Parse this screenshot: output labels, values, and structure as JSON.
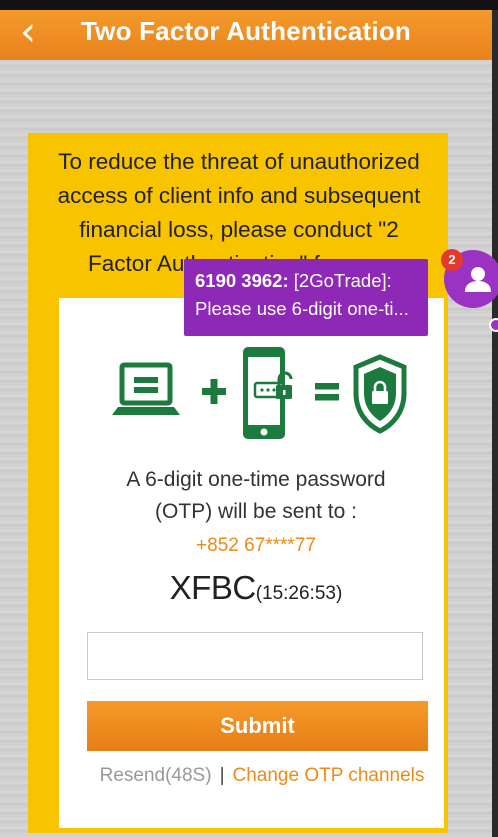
{
  "header": {
    "title": "Two Factor Authentication",
    "back_icon": "chevron-left-icon"
  },
  "notice": {
    "text": "To reduce the threat of unauthorized access of client info and subsequent financial loss, please conduct \"2 Factor Authentication\" for your"
  },
  "illustration": {
    "icons": [
      "laptop-icon",
      "plus-icon",
      "smartphone-unlock-icon",
      "equals-icon",
      "shield-lock-icon"
    ],
    "color": "#1d7a3e"
  },
  "otp": {
    "line1": "A 6-digit one-time password",
    "line2": "(OTP) will be sent to :",
    "phone": "+852 67****77",
    "code": "XFBC",
    "time": "(15:26:53)",
    "input_value": "",
    "input_placeholder": ""
  },
  "actions": {
    "submit_label": "Submit",
    "resend_label": "Resend(48S)",
    "separator": "|",
    "change_label": "Change OTP channels"
  },
  "notification": {
    "sender": "6190 3962:",
    "line1_rest": " [2GoTrade]:",
    "line2": "Please use 6-digit one-ti...",
    "badge_count": "2",
    "avatar_icon": "person-icon"
  },
  "colors": {
    "accent": "#ef8a18",
    "notice_bg": "#f8c400",
    "toast_bg": "#8e28b6",
    "icon_green": "#1d7a3e"
  }
}
